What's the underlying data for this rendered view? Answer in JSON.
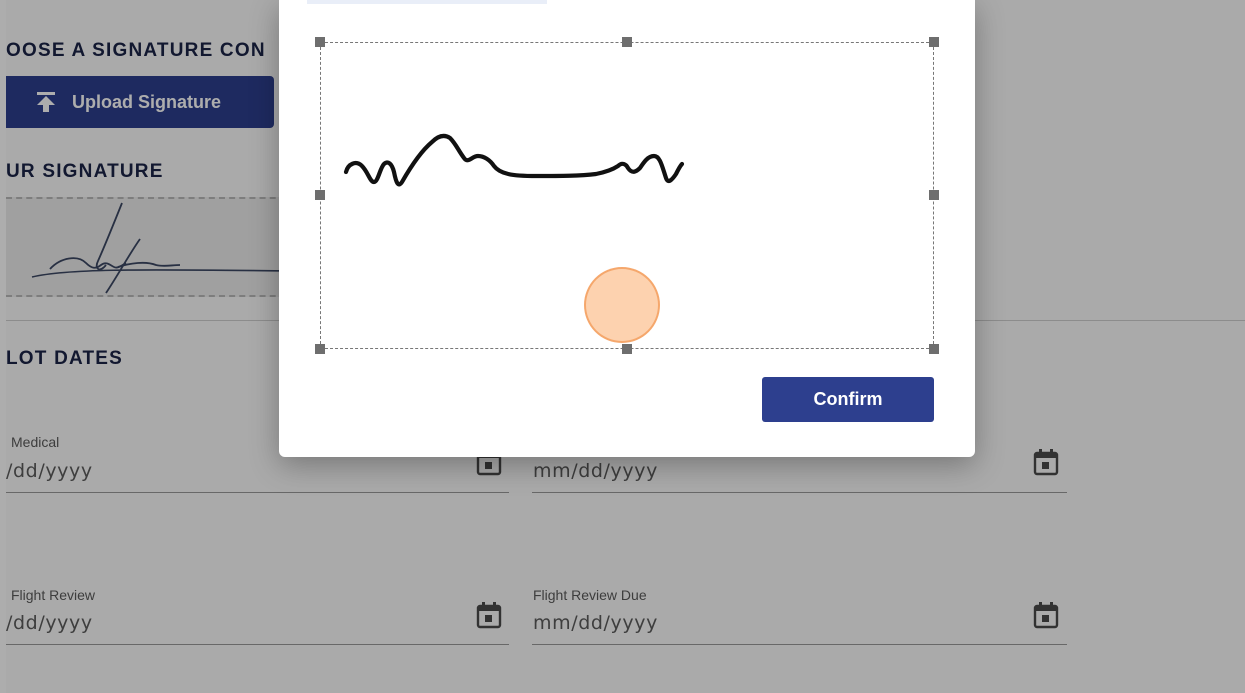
{
  "background": {
    "choose_signature_title": "OOSE A SIGNATURE CON",
    "upload_button_label": "Upload Signature",
    "your_signature_title": "UR SIGNATURE",
    "pilot_dates_title": "LOT DATES",
    "fields": [
      {
        "label": "Medical",
        "value": "/dd/yyyy"
      },
      {
        "label": "",
        "value": "mm/dd/yyyy"
      },
      {
        "label": "Flight Review",
        "value": "/dd/yyyy"
      },
      {
        "label": "Flight Review Due",
        "value": "mm/dd/yyyy"
      }
    ]
  },
  "modal": {
    "confirm_label": "Confirm"
  },
  "icons": {
    "upload": "upload-arrow-icon",
    "calendar": "calendar-icon"
  },
  "colors": {
    "primary": "#2d3f8e",
    "heading": "#1b2447",
    "cursor_highlight": "#fbb176"
  }
}
